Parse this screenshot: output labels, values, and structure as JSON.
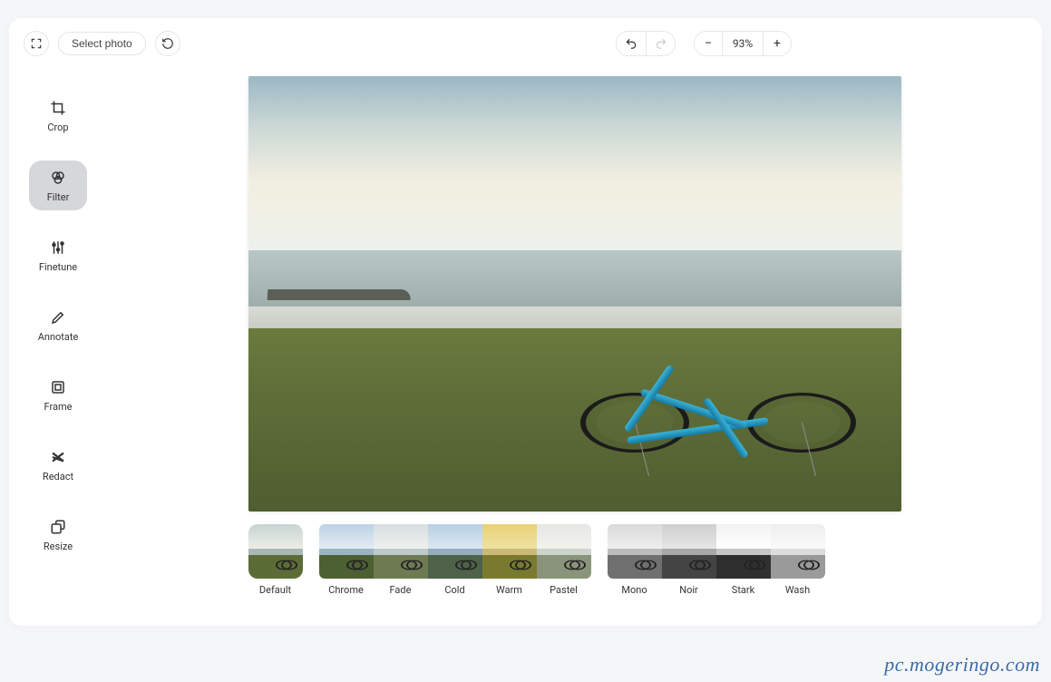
{
  "topbar": {
    "select_photo_label": "Select photo",
    "zoom_level": "93%"
  },
  "sidebar": {
    "tools": [
      {
        "key": "crop",
        "label": "Crop",
        "icon": "crop-icon"
      },
      {
        "key": "filter",
        "label": "Filter",
        "icon": "filter-icon",
        "active": true
      },
      {
        "key": "finetune",
        "label": "Finetune",
        "icon": "finetune-icon"
      },
      {
        "key": "annotate",
        "label": "Annotate",
        "icon": "annotate-icon"
      },
      {
        "key": "frame",
        "label": "Frame",
        "icon": "frame-icon"
      },
      {
        "key": "redact",
        "label": "Redact",
        "icon": "redact-icon"
      },
      {
        "key": "resize",
        "label": "Resize",
        "icon": "resize-icon"
      }
    ]
  },
  "filters": {
    "group_solo": [
      {
        "key": "default",
        "label": "Default",
        "selected": true
      }
    ],
    "group_color": [
      {
        "key": "chrome",
        "label": "Chrome"
      },
      {
        "key": "fade",
        "label": "Fade"
      },
      {
        "key": "cold",
        "label": "Cold"
      },
      {
        "key": "warm",
        "label": "Warm"
      },
      {
        "key": "pastel",
        "label": "Pastel"
      }
    ],
    "group_mono": [
      {
        "key": "mono",
        "label": "Mono"
      },
      {
        "key": "noir",
        "label": "Noir"
      },
      {
        "key": "stark",
        "label": "Stark"
      },
      {
        "key": "wash",
        "label": "Wash"
      }
    ]
  },
  "watermark": "pc.mogeringo.com"
}
